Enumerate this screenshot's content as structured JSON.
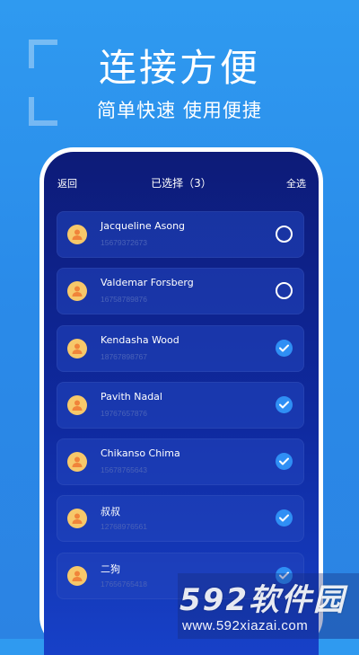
{
  "hero": {
    "title": "连接方便",
    "subtitle": "简单快速  使用便捷"
  },
  "topbar": {
    "back_label": "返回",
    "title": "已选择（3）",
    "select_all_label": "全选"
  },
  "contacts": [
    {
      "name": "Jacqueline Asong",
      "phone": "15679372673",
      "selected": false
    },
    {
      "name": "Valdemar Forsberg",
      "phone": "16758789876",
      "selected": false
    },
    {
      "name": "Kendasha Wood",
      "phone": "18767898767",
      "selected": true
    },
    {
      "name": "Pavith Nadal",
      "phone": "19767657876",
      "selected": true
    },
    {
      "name": "Chikanso Chima",
      "phone": "15678765643",
      "selected": true
    },
    {
      "name": "叔叔",
      "phone": "12768976561",
      "selected": true
    },
    {
      "name": "二狗",
      "phone": "17656765418",
      "selected": true
    }
  ],
  "watermark": {
    "brand": "592软件园",
    "url": "www.592xiazai.com"
  },
  "colors": {
    "background": "#2f9af0",
    "screen": "#0d1b78",
    "check_on": "#2f8ff5",
    "avatar": "#f7c86a"
  },
  "icons": {
    "avatar": "person-icon",
    "selected": "checkmark-icon",
    "unselected": "empty-circle-icon"
  }
}
